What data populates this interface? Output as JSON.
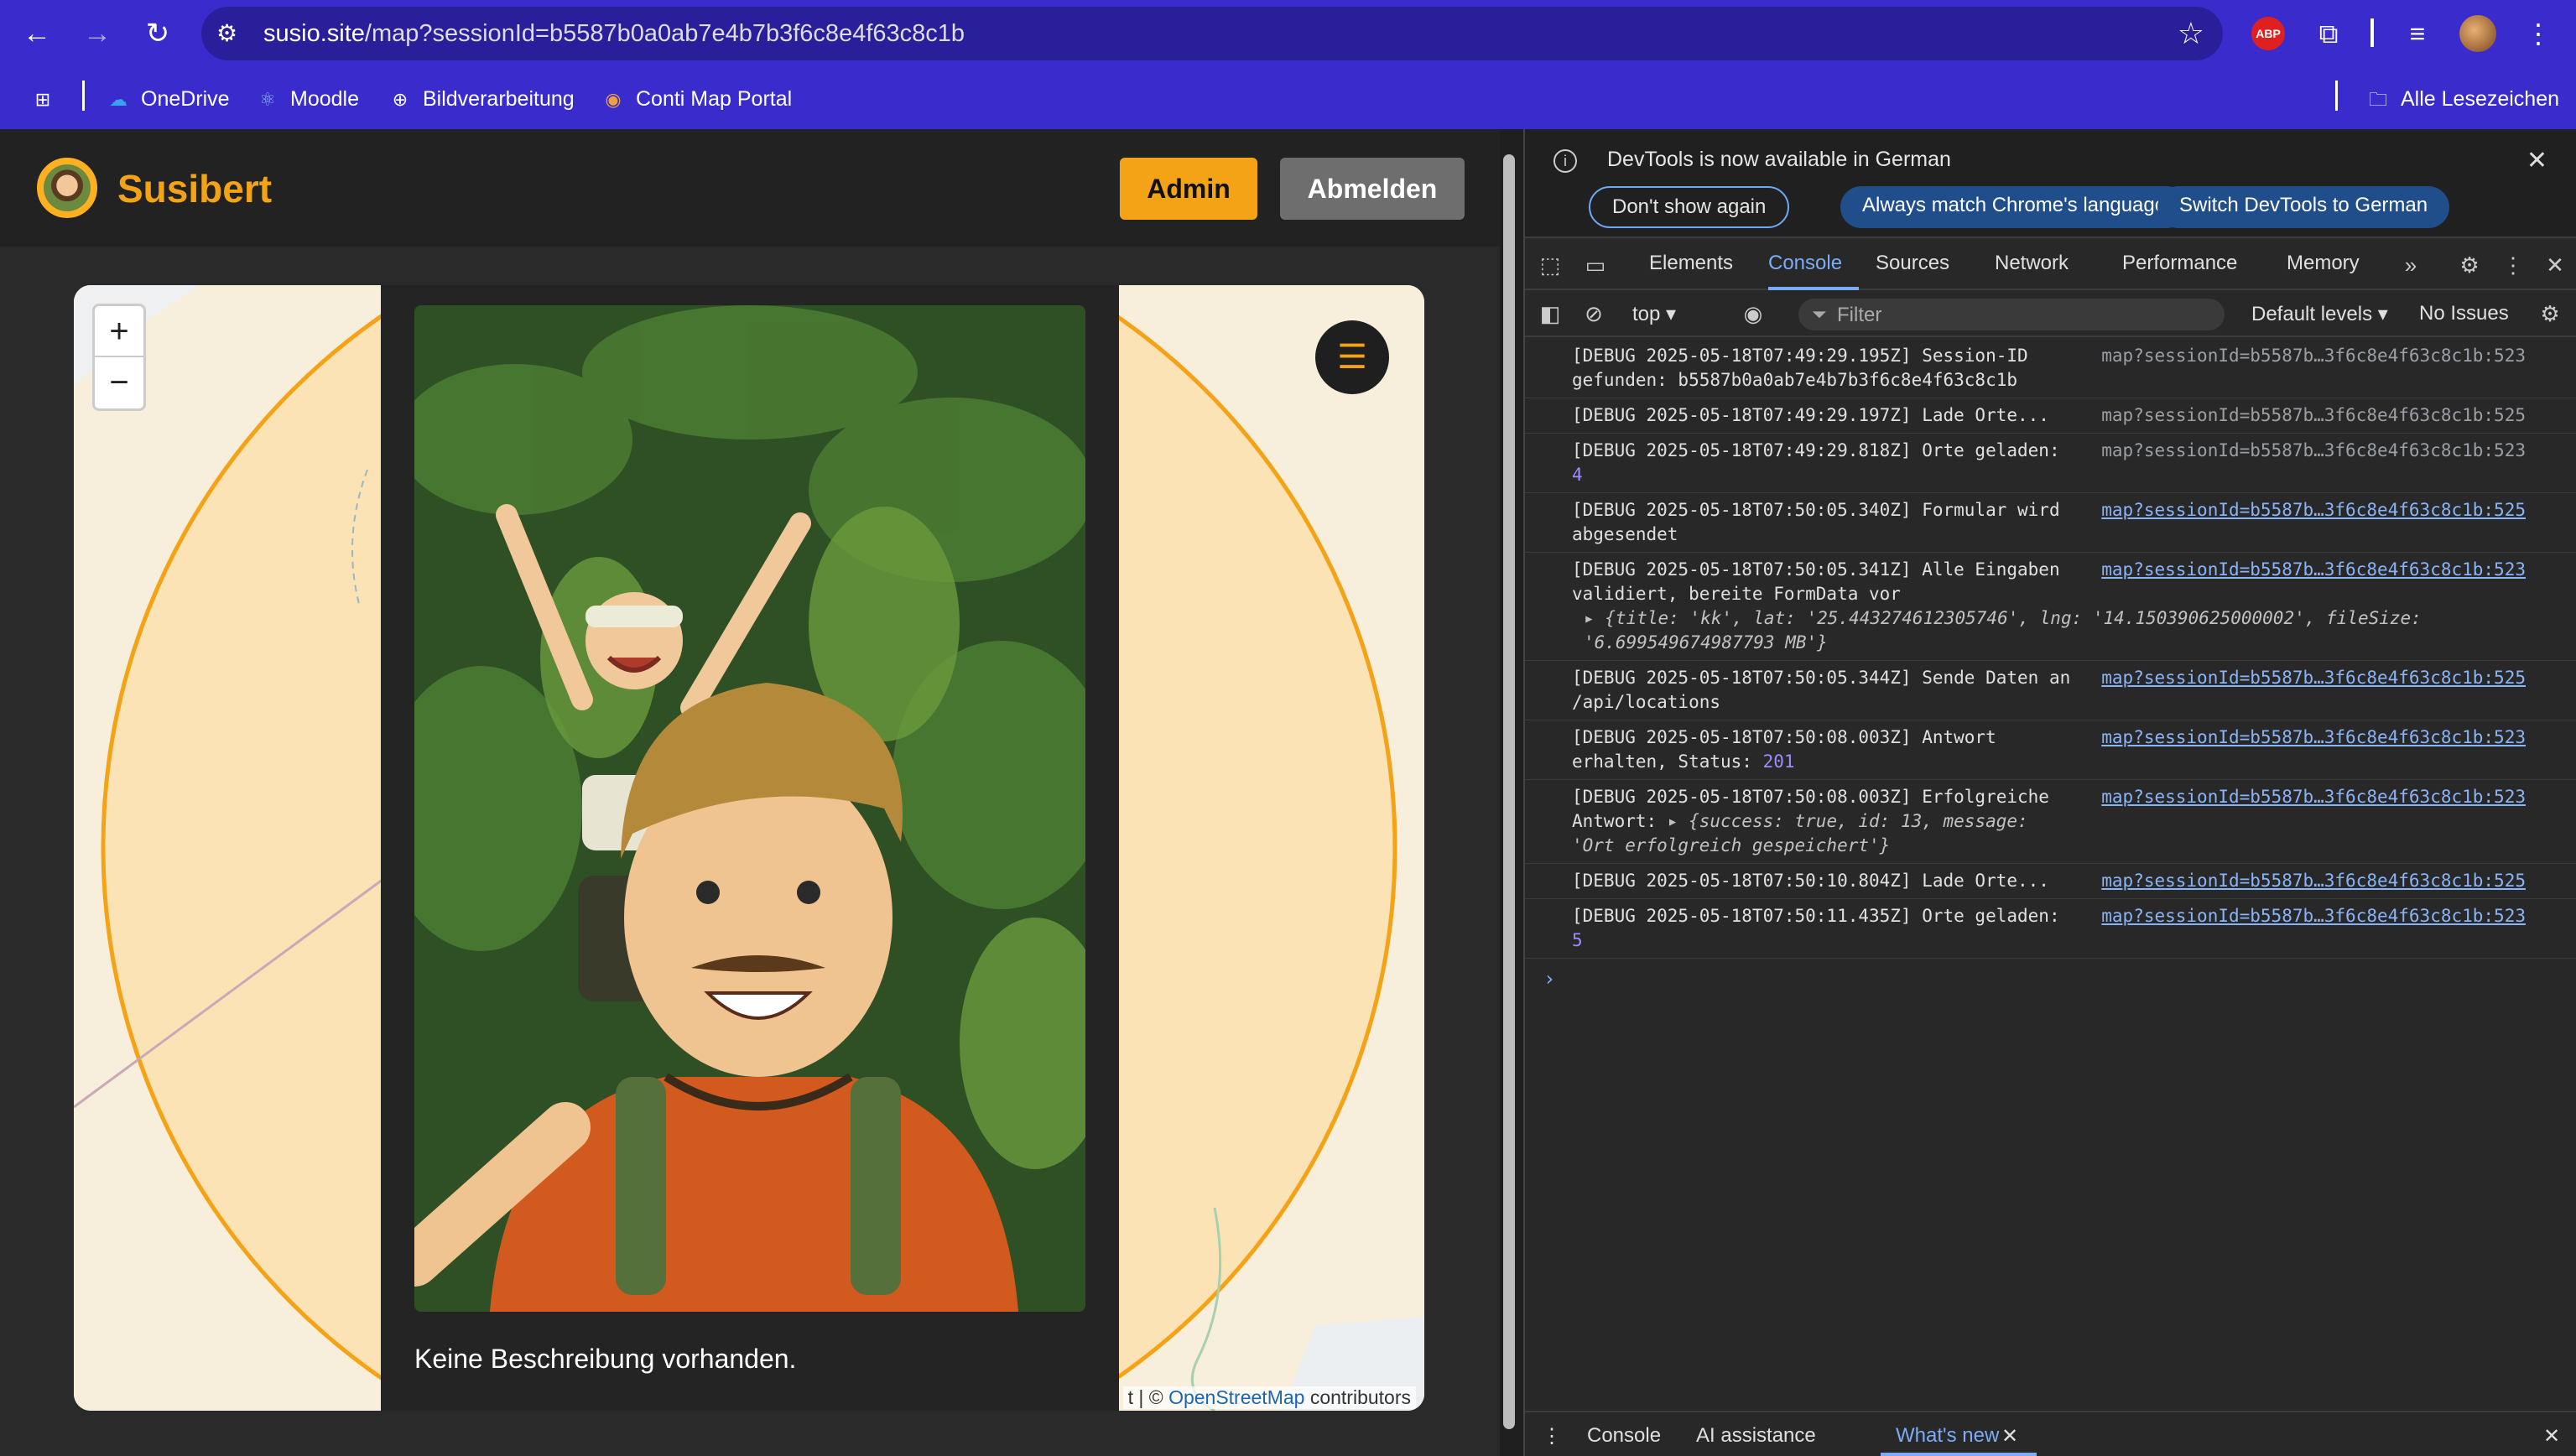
{
  "browser": {
    "url_host": "susio.site",
    "url_path": "/map?sessionId=b5587b0a0ab7e4b7b3f6c8e4f63c8c1b",
    "bookmarks": [
      "OneDrive",
      "Moodle",
      "Bildverarbeitung",
      "Conti Map Portal"
    ],
    "all_bookmarks": "Alle Lesezeichen",
    "abp_label": "ABP"
  },
  "app": {
    "brand": "Susibert",
    "admin_button": "Admin",
    "logout_button": "Abmelden",
    "zoom_in": "+",
    "zoom_out": "−",
    "menu_icon": "☰",
    "popup_caption": "Keine Beschreibung vorhanden.",
    "attribution_prefix": "t | © ",
    "attribution_link": "OpenStreetMap",
    "attribution_suffix": " contributors"
  },
  "devtools": {
    "info": {
      "text": "DevTools is now available in German",
      "dont_show": "Don't show again",
      "match_language": "Always match Chrome's language",
      "switch_german": "Switch DevTools to German"
    },
    "tabs": [
      "Elements",
      "Console",
      "Sources",
      "Network",
      "Performance",
      "Memory"
    ],
    "active_tab": "Console",
    "context": "top ▾",
    "filter_placeholder": "Filter",
    "levels": "Default levels ▾",
    "issues": "No Issues",
    "messages": [
      {
        "text": "[DEBUG 2025-05-18T07:49:29.195Z] Session-ID gefunden: b5587b0a0ab7e4b7b3f6c8e4f63c8c1b",
        "source": "map?sessionId=b5587b…3f6c8e4f63c8c1b:523"
      },
      {
        "text": "[DEBUG 2025-05-18T07:49:29.197Z] Lade Orte...",
        "source": "map?sessionId=b5587b…3f6c8e4f63c8c1b:525"
      },
      {
        "text": "[DEBUG 2025-05-18T07:49:29.818Z] Orte geladen: ",
        "num": "4",
        "source": "map?sessionId=b5587b…3f6c8e4f63c8c1b:523"
      },
      {
        "text": "[DEBUG 2025-05-18T07:50:05.340Z] Formular wird abgesendet",
        "source": "map?sessionId=b5587b…3f6c8e4f63c8c1b:525"
      },
      {
        "text": "[DEBUG 2025-05-18T07:50:05.341Z] Alle Eingaben validiert, bereite FormData vor",
        "object": "▸ {title: 'kk', lat: '25.443274612305746', lng: '14.150390625000002', fileSize: '6.699549674987793 MB'}",
        "source": "map?sessionId=b5587b…3f6c8e4f63c8c1b:523"
      },
      {
        "text": "[DEBUG 2025-05-18T07:50:05.344Z] Sende Daten an /api/locations",
        "source": "map?sessionId=b5587b…3f6c8e4f63c8c1b:525"
      },
      {
        "text": "[DEBUG 2025-05-18T07:50:08.003Z] Antwort erhalten, Status: ",
        "num": "201",
        "source": "map?sessionId=b5587b…3f6c8e4f63c8c1b:523"
      },
      {
        "text": "[DEBUG 2025-05-18T07:50:08.003Z] Erfolgreiche Antwort: ",
        "object": "▸ {success: true, id: 13, message: 'Ort erfolgreich gespeichert'}",
        "source": "map?sessionId=b5587b…3f6c8e4f63c8c1b:523"
      },
      {
        "text": "[DEBUG 2025-05-18T07:50:10.804Z] Lade Orte...",
        "source": "map?sessionId=b5587b…3f6c8e4f63c8c1b:525"
      },
      {
        "text": "[DEBUG 2025-05-18T07:50:11.435Z] Orte geladen: ",
        "num": "5",
        "source": "map?sessionId=b5587b…3f6c8e4f63c8c1b:523"
      }
    ],
    "drawer": {
      "console": "Console",
      "ai": "AI assistance",
      "whats_new": "What's new"
    }
  },
  "colors": {
    "browser_frame": "#3a2ccc",
    "accent": "#f5a316",
    "devtools_accent": "#7cacf8"
  }
}
